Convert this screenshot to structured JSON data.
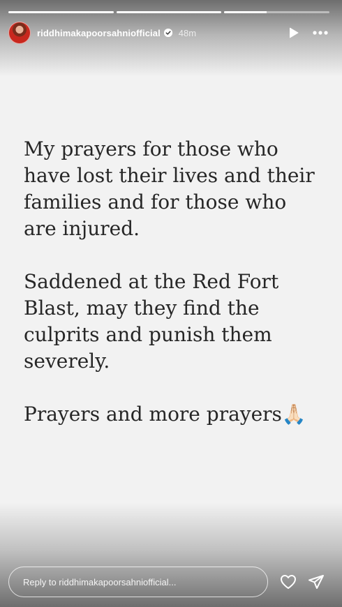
{
  "story": {
    "progress": [
      1.0,
      1.0,
      0.4
    ],
    "author": {
      "username": "riddhimakapoorsahniofficial",
      "verified": true,
      "time_ago": "48m",
      "avatar_icon": "avatar"
    },
    "controls": {
      "play_icon": "play-icon",
      "more_icon": "more-options-icon"
    },
    "background_color": "#f2f2f2",
    "text_color": "#262626",
    "paragraphs": [
      "My prayers for those who have lost their lives and their families and for those who are injured.",
      "Saddened at the Red Fort Blast, may they find the culprits and punish them severely.",
      "Prayers and more prayers🙏🏻"
    ]
  },
  "footer": {
    "reply_placeholder": "Reply to riddhimakapoorsahniofficial...",
    "like_icon": "heart-icon",
    "share_icon": "send-icon"
  }
}
